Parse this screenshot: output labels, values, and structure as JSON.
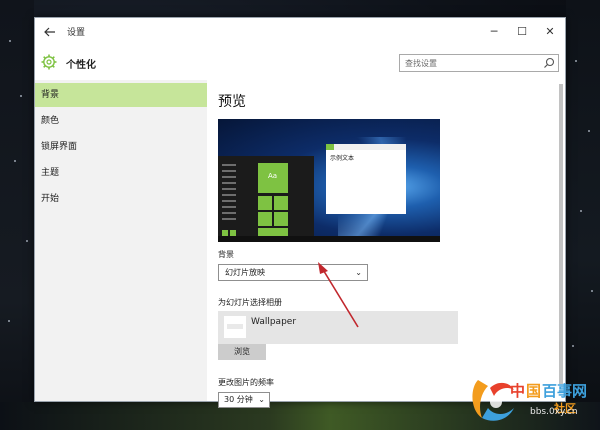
{
  "window": {
    "title": "设置",
    "back_icon": "arrow-left-icon",
    "controls": {
      "minimize": "─",
      "maximize": "☐",
      "close": "✕"
    }
  },
  "header": {
    "app_title": "个性化",
    "icon": "gear-icon",
    "search": {
      "placeholder": "查找设置",
      "value": ""
    }
  },
  "sidebar": {
    "items": [
      {
        "label": "背景",
        "active": true
      },
      {
        "label": "颜色",
        "active": false
      },
      {
        "label": "锁屏界面",
        "active": false
      },
      {
        "label": "主题",
        "active": false
      },
      {
        "label": "开始",
        "active": false
      }
    ]
  },
  "main": {
    "preview_title": "预览",
    "preview": {
      "tile_text": "Aa",
      "sample_text": "示例文本"
    },
    "background": {
      "label": "背景",
      "selected": "幻灯片放映"
    },
    "album": {
      "label": "为幻灯片选择相册",
      "name": "Wallpaper",
      "browse_label": "浏览"
    },
    "frequency": {
      "label": "更改图片的频率",
      "selected": "30 分钟"
    }
  },
  "watermark": {
    "brand": "中国百事网",
    "sub": "社区",
    "url": "bbs.0xy.cn"
  },
  "colors": {
    "accent": "#7ec242",
    "active_nav": "#c6e59a",
    "annotation_arrow": "#c1272d"
  }
}
